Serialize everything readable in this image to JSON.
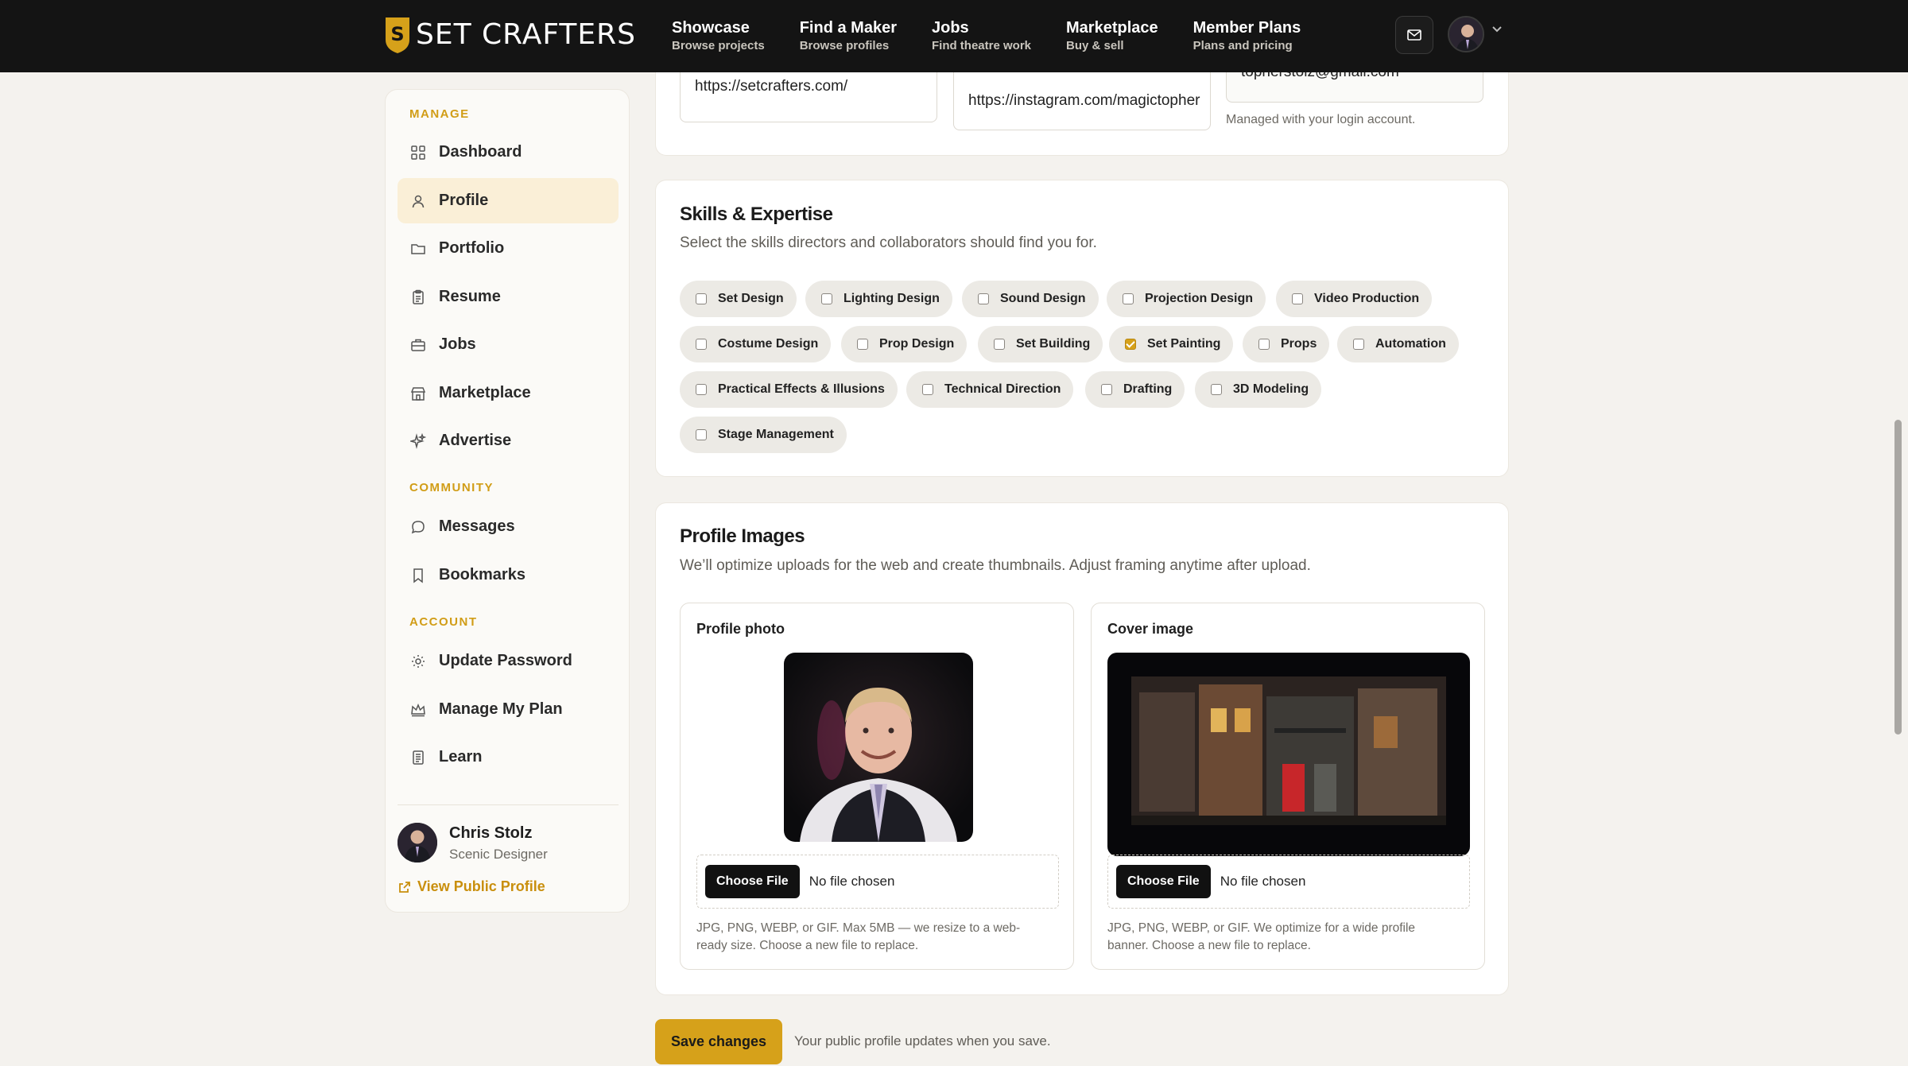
{
  "brand": {
    "name": "SET CRAFTERS",
    "accent": "#d6a11a"
  },
  "nav": [
    {
      "title": "Showcase",
      "sub": "Browse projects"
    },
    {
      "title": "Find a Maker",
      "sub": "Browse profiles"
    },
    {
      "title": "Jobs",
      "sub": "Find theatre work"
    },
    {
      "title": "Marketplace",
      "sub": "Buy & sell"
    },
    {
      "title": "Member Plans",
      "sub": "Plans and pricing"
    }
  ],
  "sidebar": {
    "manage_label": "MANAGE",
    "community_label": "COMMUNITY",
    "account_label": "ACCOUNT",
    "items": [
      {
        "label": "Dashboard",
        "icon": "grid-icon"
      },
      {
        "label": "Profile",
        "icon": "user-icon"
      },
      {
        "label": "Portfolio",
        "icon": "folder-icon"
      },
      {
        "label": "Resume",
        "icon": "clipboard-icon"
      },
      {
        "label": "Jobs",
        "icon": "briefcase-icon"
      },
      {
        "label": "Marketplace",
        "icon": "store-icon"
      },
      {
        "label": "Advertise",
        "icon": "sparkles-icon"
      },
      {
        "label": "Messages",
        "icon": "chat-icon"
      },
      {
        "label": "Bookmarks",
        "icon": "bookmark-icon"
      },
      {
        "label": "Update Password",
        "icon": "sun-icon"
      },
      {
        "label": "Manage My Plan",
        "icon": "crown-icon"
      },
      {
        "label": "Learn",
        "icon": "book-icon"
      }
    ],
    "user": {
      "name": "Chris Stolz",
      "role": "Scenic Designer"
    },
    "view_public": "View Public Profile"
  },
  "links": {
    "website": "https://setcrafters.com/",
    "instagram": "https://instagram.com/magictopher",
    "email": "topherstolz@gmail.com",
    "email_note": "Managed with your login account."
  },
  "skills": {
    "title": "Skills & Expertise",
    "subtitle": "Select the skills directors and collaborators should find you for.",
    "items": [
      {
        "label": "Set Design",
        "checked": false
      },
      {
        "label": "Lighting Design",
        "checked": false
      },
      {
        "label": "Sound Design",
        "checked": false
      },
      {
        "label": "Projection Design",
        "checked": false
      },
      {
        "label": "Video Production",
        "checked": false
      },
      {
        "label": "Costume Design",
        "checked": false
      },
      {
        "label": "Prop Design",
        "checked": false
      },
      {
        "label": "Set Building",
        "checked": false
      },
      {
        "label": "Set Painting",
        "checked": true
      },
      {
        "label": "Props",
        "checked": false
      },
      {
        "label": "Automation",
        "checked": false
      },
      {
        "label": "Practical Effects & Illusions",
        "checked": false
      },
      {
        "label": "Technical Direction",
        "checked": false
      },
      {
        "label": "Drafting",
        "checked": false
      },
      {
        "label": "3D Modeling",
        "checked": false
      },
      {
        "label": "Stage Management",
        "checked": false
      }
    ]
  },
  "images": {
    "title": "Profile Images",
    "subtitle": "We’ll optimize uploads for the web and create thumbnails. Adjust framing anytime after upload.",
    "profile": {
      "title": "Profile photo",
      "choose": "Choose File",
      "status": "No file chosen",
      "help": "JPG, PNG, WEBP, or GIF. Max 5MB — we resize to a web-ready size. Choose a new file to replace."
    },
    "cover": {
      "title": "Cover image",
      "choose": "Choose File",
      "status": "No file chosen",
      "help": "JPG, PNG, WEBP, or GIF. We optimize for a wide profile banner. Choose a new file to replace."
    }
  },
  "save": {
    "label": "Save changes",
    "note": "Your public profile updates when you save."
  }
}
